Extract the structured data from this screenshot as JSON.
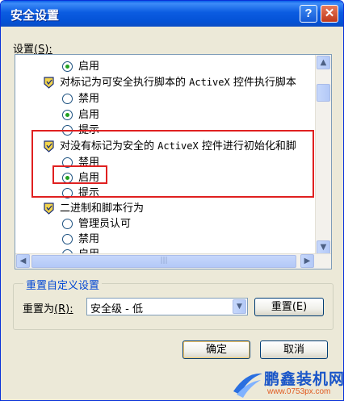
{
  "window": {
    "title": "安全设置",
    "help_glyph": "?",
    "close_glyph": "✕"
  },
  "settings": {
    "label": "设置",
    "mnemonic": "(S):",
    "items": [
      {
        "kind": "radio",
        "checked": true,
        "label": "启用"
      },
      {
        "kind": "header",
        "label_cn1": "对标记为可安全执行脚本的 ",
        "label_mono": "ActiveX",
        "label_cn2": " 控件执行脚本"
      },
      {
        "kind": "radio",
        "checked": false,
        "label": "禁用"
      },
      {
        "kind": "radio",
        "checked": true,
        "label": "启用"
      },
      {
        "kind": "radio",
        "checked": false,
        "label": "提示"
      },
      {
        "kind": "header",
        "label_cn1": "对没有标记为安全的 ",
        "label_mono": "ActiveX",
        "label_cn2": " 控件进行初始化和脚"
      },
      {
        "kind": "radio",
        "checked": false,
        "label": "禁用"
      },
      {
        "kind": "radio",
        "checked": true,
        "label": "启用"
      },
      {
        "kind": "radio",
        "checked": false,
        "label": "提示"
      },
      {
        "kind": "header",
        "label_cn1": "二进制和脚本行为",
        "label_mono": "",
        "label_cn2": ""
      },
      {
        "kind": "radio",
        "checked": false,
        "label": "管理员认可"
      },
      {
        "kind": "radio",
        "checked": false,
        "label": "禁用"
      },
      {
        "kind": "radio",
        "checked": false,
        "label": "启用"
      }
    ],
    "scroll_up": "▲",
    "scroll_down": "▼",
    "scroll_left": "◀",
    "scroll_right": "▶",
    "hthumb_grip": "|||"
  },
  "reset_group": {
    "title": "重置自定义设置",
    "reset_to_label": "重置为",
    "reset_to_mnemonic": "(R):",
    "level_value": "安全级 - 低",
    "dropdown_glyph": "▼",
    "reset_button": "重置",
    "reset_button_mnemonic": "(E)"
  },
  "buttons": {
    "ok": "确定",
    "cancel": "取消"
  },
  "watermark": {
    "title": "鹏鑫装机网",
    "url": "www.0753px.com"
  },
  "colors": {
    "titlebar": "#0452d6",
    "highlight": "#e02020",
    "radio_dot": "#21a121",
    "group_title": "#0046d5"
  },
  "icons": {
    "shield": "shield-icon",
    "radio": "radio-button"
  }
}
